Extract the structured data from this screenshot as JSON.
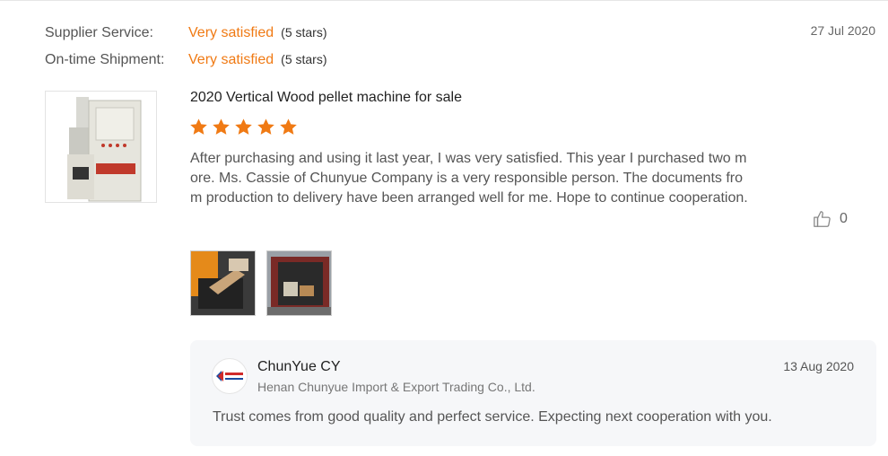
{
  "ratings": {
    "supplier_service": {
      "label": "Supplier Service:",
      "value": "Very satisfied",
      "stars": "(5 stars)"
    },
    "ontime_shipment": {
      "label": "On-time Shipment:",
      "value": "Very satisfied",
      "stars": "(5 stars)"
    }
  },
  "review": {
    "date": "27 Jul 2020",
    "product_title": "2020 Vertical Wood pellet machine for sale",
    "star_count": 5,
    "star_color": "#f07a14",
    "text": "After purchasing and using it last year, I was very satisfied. This year I purchased two more. Ms. Cassie of Chunyue Company is a very responsible person. The documents from production to delivery have been arranged well for me. Hope to continue cooperation.",
    "likes": "0",
    "like_icon": "thumbs-up-icon"
  },
  "reply": {
    "name": "ChunYue CY",
    "company": "Henan Chunyue Import & Export Trading Co., Ltd.",
    "date": "13 Aug 2020",
    "text": "Trust comes from good quality and perfect service.  Expecting next cooperation with you."
  },
  "colors": {
    "accent": "#f07a14",
    "reply_bg": "#f6f7f9"
  }
}
